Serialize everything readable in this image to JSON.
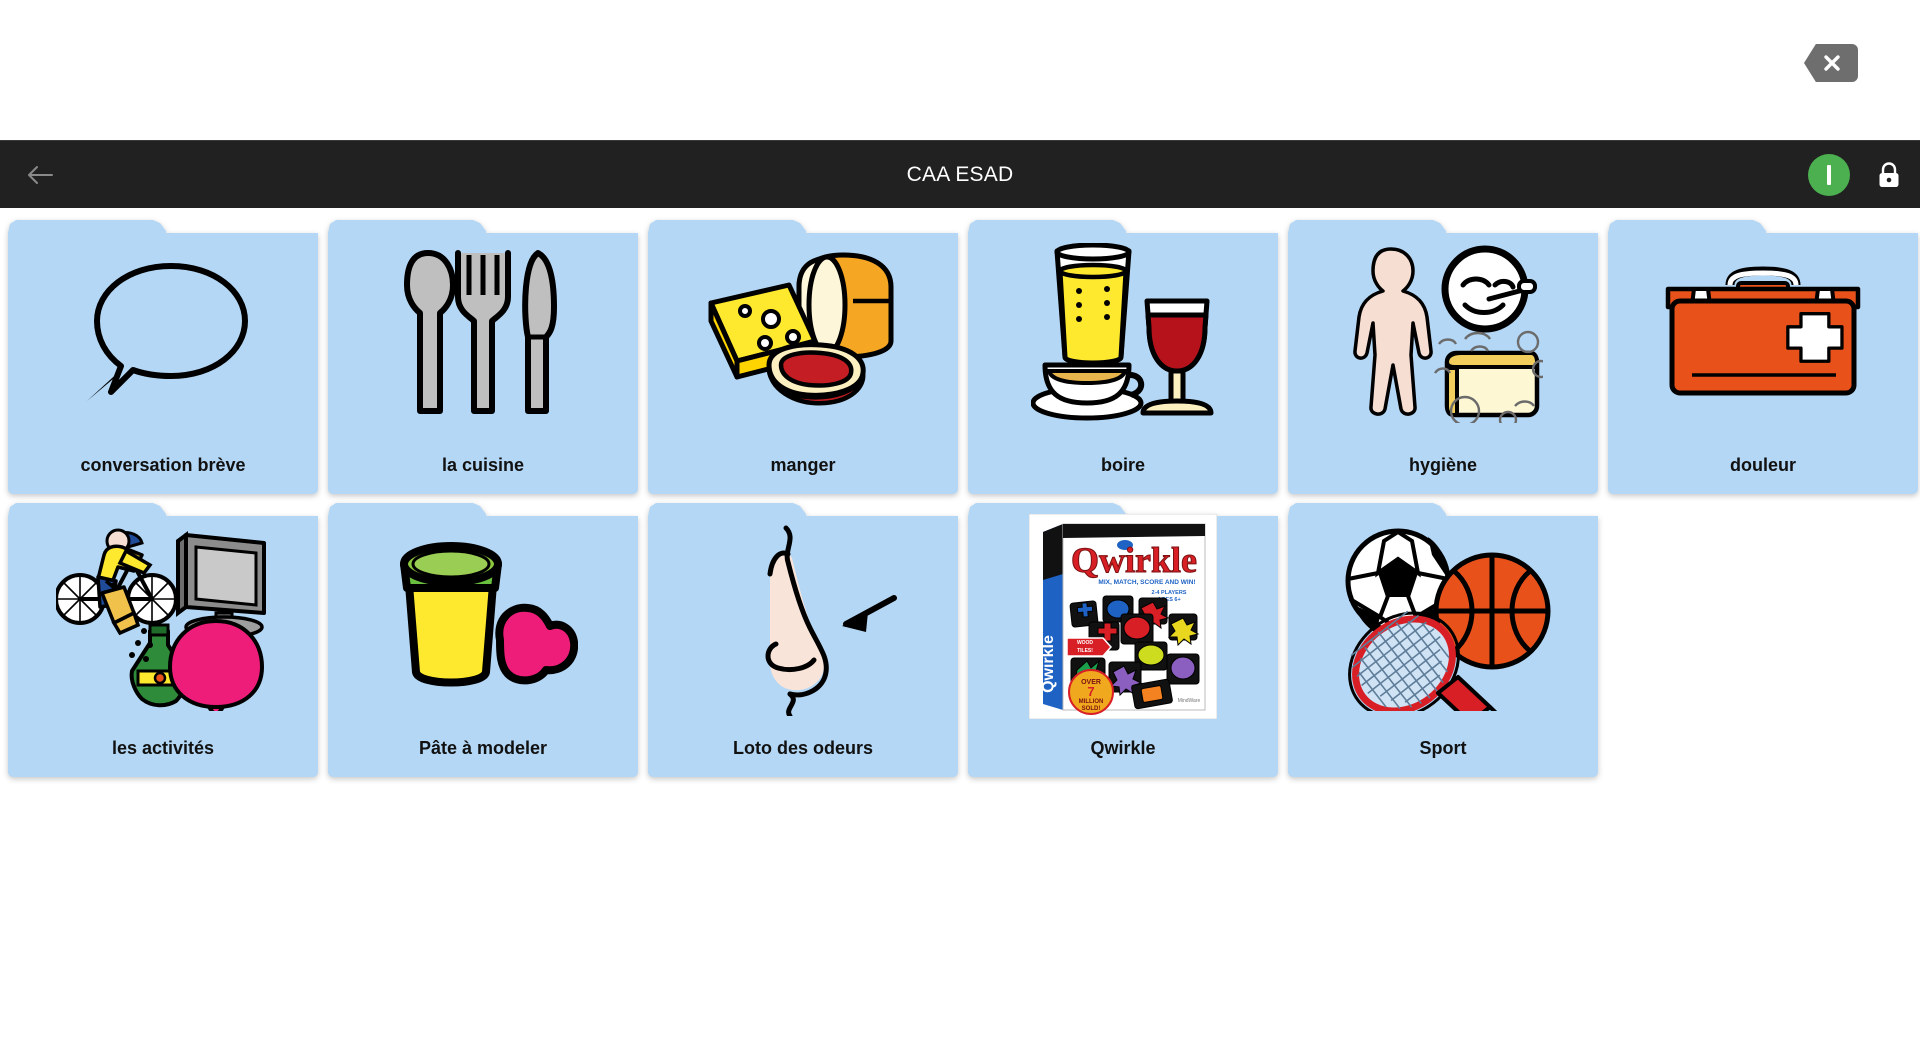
{
  "window": {
    "close_button": "close-icon"
  },
  "header": {
    "title": "CAA ESAD",
    "back_icon": "back-arrow-icon",
    "info_icon": "info-icon",
    "info_letter": "I",
    "lock_icon": "lock-icon",
    "background_color": "#212121",
    "info_color": "#4caf50"
  },
  "board": {
    "card_color": "#b3d7f5",
    "rows": [
      [
        {
          "label": "conversation brève",
          "icon": "speech-bubble-icon"
        },
        {
          "label": "la cuisine",
          "icon": "cutlery-icon"
        },
        {
          "label": "manger",
          "icon": "food-icon"
        },
        {
          "label": "boire",
          "icon": "drinks-icon"
        },
        {
          "label": "hygiène",
          "icon": "hygiene-icon"
        },
        {
          "label": "douleur",
          "icon": "first-aid-kit-icon"
        }
      ],
      [
        {
          "label": "les activités",
          "icon": "activities-icon"
        },
        {
          "label": "Pâte à modeler",
          "icon": "modeling-clay-icon"
        },
        {
          "label": "Loto des odeurs",
          "icon": "nose-smell-icon"
        },
        {
          "label": "Qwirkle",
          "icon": "qwirkle-box-photo"
        },
        {
          "label": "Sport",
          "icon": "sports-balls-icon"
        }
      ]
    ]
  },
  "qwirkle_box": {
    "title": "Qwirkle",
    "tagline": "MIX, MATCH, SCORE AND WIN!",
    "players": "2-4 PLAYERS",
    "ages": "AGES 6+",
    "badge_line1": "OVER",
    "badge_line2": "7",
    "badge_line3": "MILLION",
    "badge_line4": "SOLD!",
    "wood_tiles": "WOOD TILES!",
    "brand": "MindWare"
  }
}
